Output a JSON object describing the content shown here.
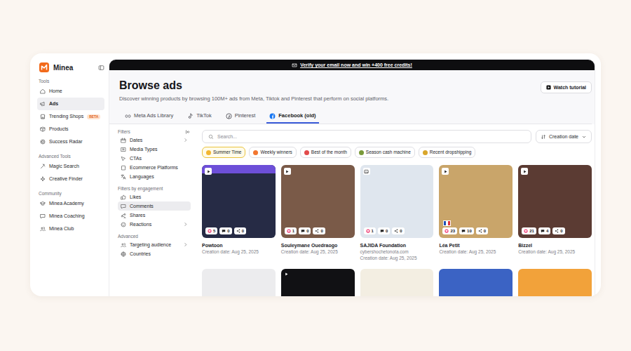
{
  "logo": {
    "name": "Minea"
  },
  "banner": {
    "text": "Verify your email now and win +400 free credits!"
  },
  "sidebar": {
    "sections": [
      {
        "label": "Tools",
        "items": [
          {
            "label": "Home",
            "selected": false
          },
          {
            "label": "Ads",
            "selected": true
          },
          {
            "label": "Trending Shops",
            "selected": false,
            "badge": "BETA"
          },
          {
            "label": "Products",
            "selected": false
          },
          {
            "label": "Success Radar",
            "selected": false
          }
        ]
      },
      {
        "label": "Advanced Tools",
        "items": [
          {
            "label": "Magic Search",
            "selected": false
          },
          {
            "label": "Creative Finder",
            "selected": false
          }
        ]
      },
      {
        "label": "Community",
        "items": [
          {
            "label": "Minea Academy",
            "selected": false
          },
          {
            "label": "Minea Coaching",
            "selected": false
          },
          {
            "label": "Minea Club",
            "selected": false
          }
        ]
      }
    ]
  },
  "page": {
    "title": "Browse ads",
    "subtitle": "Discover winning products by browsing 100M+ ads from Meta, Tiktok and Pinterest that perform on social platforms.",
    "tutorial_button": "Watch tutorial"
  },
  "tabs": [
    {
      "label": "Meta Ads Library",
      "selected": false
    },
    {
      "label": "TikTok",
      "selected": false
    },
    {
      "label": "Pinterest",
      "selected": false
    },
    {
      "label": "Facebook (old)",
      "selected": true
    }
  ],
  "filters": {
    "groups": [
      {
        "title": "Filters",
        "items": [
          {
            "label": "Dates",
            "selected": false,
            "has_submenu": true
          },
          {
            "label": "Media Types",
            "selected": false,
            "has_submenu": false
          },
          {
            "label": "CTAs",
            "selected": false,
            "has_submenu": false
          },
          {
            "label": "Ecommerce Platforms",
            "selected": false,
            "has_submenu": false
          },
          {
            "label": "Languages",
            "selected": false,
            "has_submenu": false
          }
        ]
      },
      {
        "title": "Filters by engagement",
        "items": [
          {
            "label": "Likes",
            "selected": false,
            "has_submenu": false
          },
          {
            "label": "Comments",
            "selected": true,
            "has_submenu": false
          },
          {
            "label": "Shares",
            "selected": false,
            "has_submenu": false
          },
          {
            "label": "Reactions",
            "selected": false,
            "has_submenu": true
          }
        ]
      },
      {
        "title": "Advanced",
        "items": [
          {
            "label": "Targeting audience",
            "selected": false,
            "has_submenu": true
          },
          {
            "label": "Countries",
            "selected": false,
            "has_submenu": false
          }
        ]
      }
    ]
  },
  "search": {
    "placeholder": "Search..."
  },
  "sort": {
    "label": "Creation date"
  },
  "chips": [
    {
      "label": "Summer Time",
      "selected": true
    },
    {
      "label": "Weekly winners",
      "selected": false
    },
    {
      "label": "Best of the month",
      "selected": false
    },
    {
      "label": "Season cash machine",
      "selected": false
    },
    {
      "label": "Recent dropshipping",
      "selected": false
    }
  ],
  "ads": [
    {
      "name": "Powtoon",
      "date": "Creation date: Aug 25, 2025",
      "kind": "video",
      "flag": false,
      "stats": {
        "likes": "5",
        "comments": "0",
        "shares": "0"
      }
    },
    {
      "name": "Souleymane Ouedraogo",
      "date": "Creation date: Aug 25, 2025",
      "kind": "video",
      "flag": false,
      "stats": {
        "likes": "1",
        "comments": "0",
        "shares": "0"
      }
    },
    {
      "name": "SAJIDA Foundation",
      "domain": "cybershochetonota.com",
      "date": "Creation date: Aug 25, 2025",
      "kind": "image",
      "flag": false,
      "stats": {
        "likes": "1",
        "comments": "0",
        "shares": "0"
      }
    },
    {
      "name": "Léa Petit",
      "date": "Creation date: Aug 25, 2025",
      "kind": "video",
      "flag": true,
      "stats": {
        "likes": "23",
        "comments": "10",
        "shares": "0"
      }
    },
    {
      "name": "Bizzel",
      "date": "Creation date: Aug 25, 2025",
      "kind": "video",
      "flag": false,
      "stats": {
        "likes": "21",
        "comments": "4",
        "shares": "0"
      }
    }
  ],
  "partial_ads": [
    {
      "kind": "none"
    },
    {
      "kind": "video"
    },
    {
      "kind": "none"
    },
    {
      "kind": "none"
    },
    {
      "kind": "none"
    }
  ]
}
